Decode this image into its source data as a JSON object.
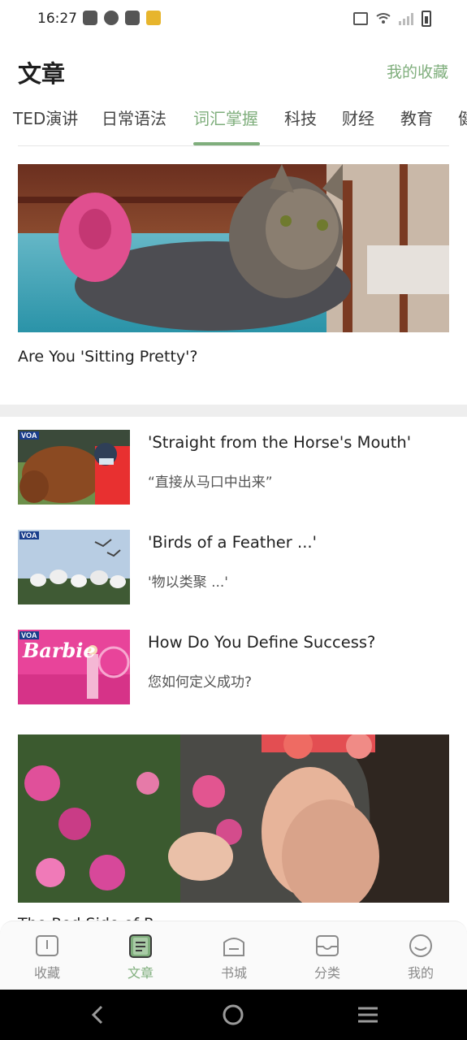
{
  "status_bar": {
    "time": "16:27"
  },
  "header": {
    "title": "文章",
    "favorites_link": "我的收藏"
  },
  "tabs": [
    {
      "label": "TED演讲",
      "active": false
    },
    {
      "label": "日常语法",
      "active": false
    },
    {
      "label": "词汇掌握",
      "active": true
    },
    {
      "label": "科技",
      "active": false
    },
    {
      "label": "财经",
      "active": false
    },
    {
      "label": "教育",
      "active": false
    },
    {
      "label": "健",
      "active": false
    }
  ],
  "feature_articles": [
    {
      "title": "Are You 'Sitting Pretty'?"
    },
    {
      "title": "The Red Side of R..."
    }
  ],
  "list_articles": [
    {
      "title": "'Straight from the Horse's Mouth'",
      "subtitle": "“直接从马口中出来”",
      "badge": "VOA"
    },
    {
      "title": "'Birds of a Feather ...'",
      "subtitle": "'物以类聚 ...'",
      "badge": "VOA"
    },
    {
      "title": "How Do You Define Success?",
      "subtitle": "您如何定义成功?",
      "badge": "VOA",
      "thumb_text": "Barbie"
    }
  ],
  "bottom_nav": [
    {
      "label": "收藏",
      "icon": "bookmark-book-icon",
      "active": false
    },
    {
      "label": "文章",
      "icon": "article-icon",
      "active": true
    },
    {
      "label": "书城",
      "icon": "bookstore-icon",
      "active": false
    },
    {
      "label": "分类",
      "icon": "category-tray-icon",
      "active": false
    },
    {
      "label": "我的",
      "icon": "profile-face-icon",
      "active": false
    }
  ],
  "colors": {
    "accent": "#7fae7c",
    "text": "#222222",
    "muted": "#8a8a8a",
    "divider": "#eeeeee"
  }
}
